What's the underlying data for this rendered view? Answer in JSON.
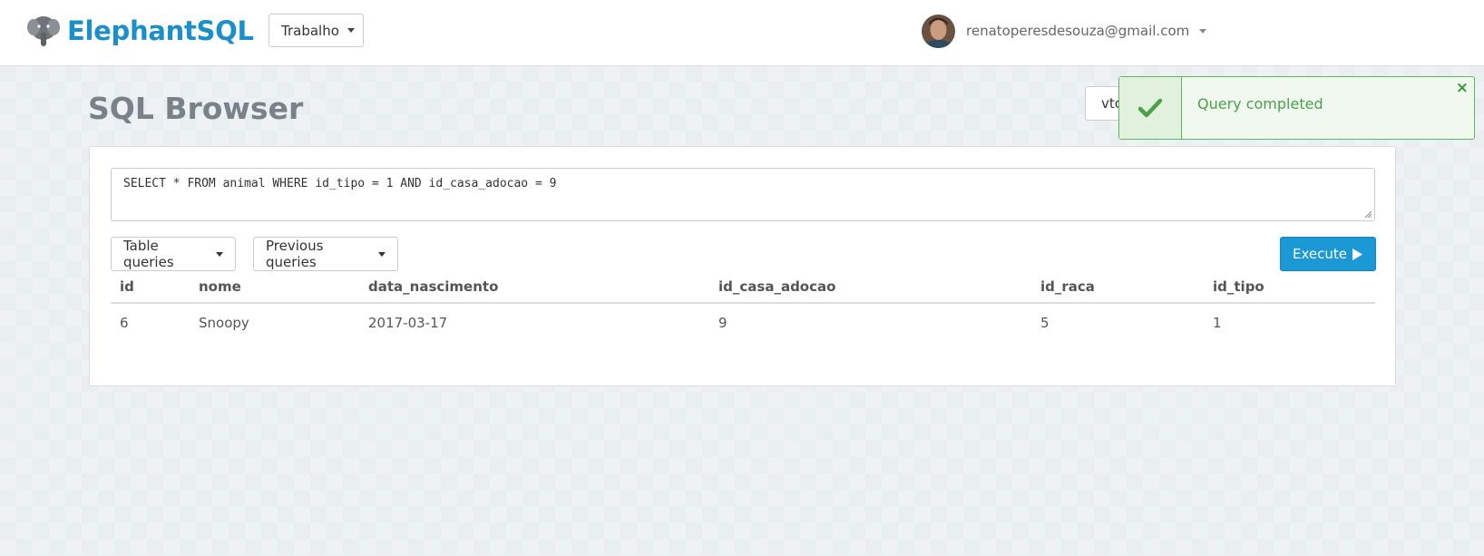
{
  "brand": {
    "name": "ElephantSQL",
    "color": "#1b8fc9"
  },
  "team_selector": {
    "selected": "Trabalho"
  },
  "user": {
    "email": "renatoperesdesouza@gmail.com"
  },
  "page": {
    "title": "SQL Browser",
    "instance_select_value": "vtc"
  },
  "toast": {
    "message": "Query completed",
    "close_glyph": "×",
    "color": "#5cb85c"
  },
  "query": {
    "text": "SELECT * FROM animal WHERE id_tipo = 1 AND id_casa_adocao = 9"
  },
  "buttons": {
    "table_queries": "Table queries",
    "previous_queries": "Previous queries",
    "execute": "Execute",
    "execute_color": "#1b98d6"
  },
  "results": {
    "columns": [
      "id",
      "nome",
      "data_nascimento",
      "id_casa_adocao",
      "id_raca",
      "id_tipo"
    ],
    "rows": [
      [
        "6",
        "Snoopy",
        "2017-03-17",
        "9",
        "5",
        "1"
      ]
    ]
  },
  "icons": {
    "logo": "elephant-logo-icon",
    "toast": "checkmark-icon",
    "execute": "play-icon"
  }
}
